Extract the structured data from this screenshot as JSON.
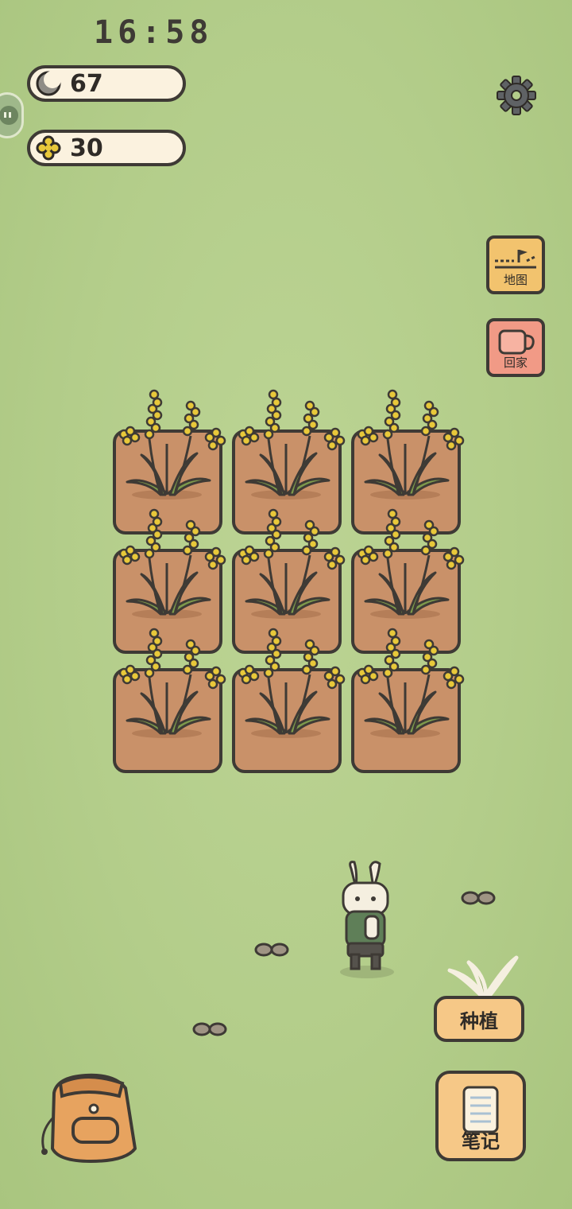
{
  "status_bar": {
    "time": "16:58"
  },
  "currencies": {
    "moon": {
      "icon": "moon-icon",
      "value": "67"
    },
    "clover": {
      "icon": "clover-icon",
      "value": "30"
    }
  },
  "top_right": {
    "settings_icon": "gear-icon"
  },
  "side_buttons": {
    "map": {
      "label": "地图",
      "icon": "map-flag-icon",
      "color": "#f2c36e"
    },
    "home": {
      "label": "回家",
      "icon": "cup-icon",
      "color": "#f19a86"
    }
  },
  "garden": {
    "rows": 3,
    "cols": 3,
    "plot_state": "grown",
    "plant": "yellow-flower-stalks"
  },
  "bottom": {
    "plant_button": {
      "label": "种植"
    },
    "notes_button": {
      "label": "笔记"
    },
    "backpack_icon": "backpack-icon"
  },
  "colors": {
    "grass": "#b3cd8a",
    "soil": "#c99169",
    "outline": "#3e3a35",
    "button": "#f6c887"
  }
}
